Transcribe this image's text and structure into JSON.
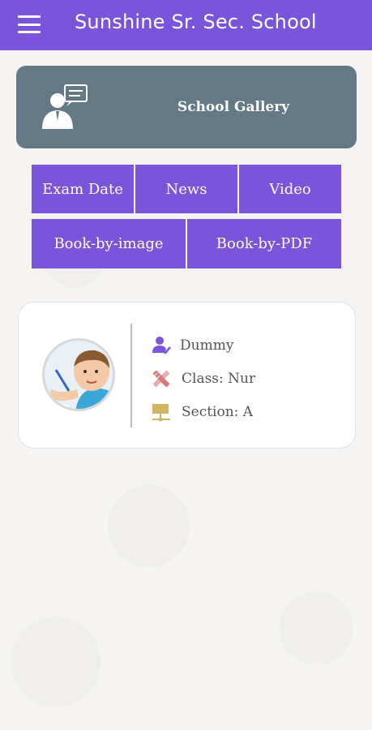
{
  "appbar": {
    "title": "Sunshine Sr. Sec. School",
    "color": "#7a55dc",
    "menu_icon": "hamburger-menu-icon"
  },
  "gallery": {
    "label": "School Gallery",
    "icon": "presenter-speech-icon",
    "color": "#647986"
  },
  "buttons": {
    "exam_date": "Exam Date",
    "news": "News",
    "video": "Video",
    "book_by_image": "Book-by-image",
    "book_by_pdf": "Book-by-PDF"
  },
  "profile": {
    "name": "Dummy",
    "class": "Class: Nur",
    "section": "Section: A",
    "name_icon": "user-check-icon",
    "class_icon": "pencil-ruler-icon",
    "section_icon": "board-icon"
  }
}
